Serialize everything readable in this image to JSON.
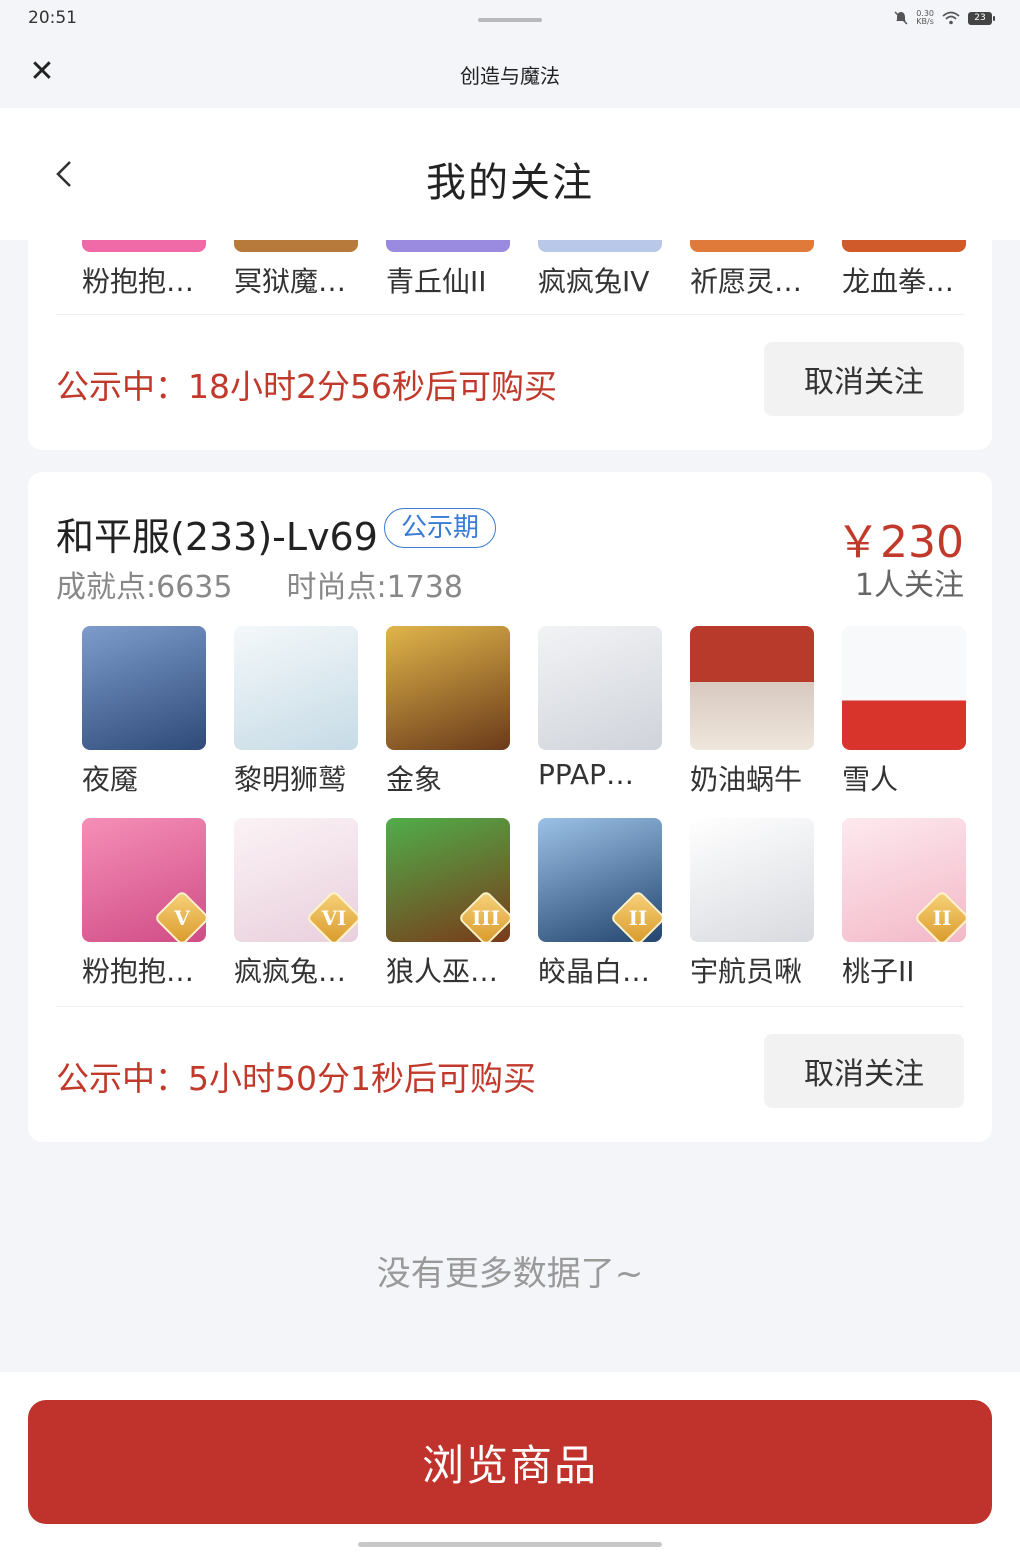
{
  "status_bar": {
    "time": "20:51",
    "net_speed_value": "0.30",
    "net_speed_unit": "KB/s",
    "battery": "23",
    "icons": [
      "bell-off-icon",
      "wifi-icon",
      "battery-icon"
    ]
  },
  "app_bar": {
    "title": "创造与魔法",
    "close_icon": "close-icon"
  },
  "page_header": {
    "title": "我的关注",
    "back_icon": "chevron-left-icon"
  },
  "card1": {
    "items": [
      {
        "label": "粉抱抱…",
        "color": "#f06aa8"
      },
      {
        "label": "冥狱魔…",
        "color": "#b87a3a"
      },
      {
        "label": "青丘仙II",
        "color": "#9b8be0"
      },
      {
        "label": "疯疯兔IV",
        "color": "#b9c7e8"
      },
      {
        "label": "祈愿灵…",
        "color": "#e07a3a"
      },
      {
        "label": "龙血拳…",
        "color": "#d05a2a"
      }
    ],
    "notice": "公示中：18小时2分56秒后可购买",
    "unfollow_label": "取消关注"
  },
  "card2": {
    "server": "和平服(233)-Lv69",
    "tag": "公示期",
    "price": "￥230",
    "achievement": "成就点:6635",
    "fashion": "时尚点:1738",
    "followers": "1人关注",
    "row1": [
      {
        "label": "夜魇",
        "color": "#4a6a9a"
      },
      {
        "label": "黎明狮鹫",
        "color": "#dfe9ef"
      },
      {
        "label": "金象",
        "color": "#b0802a"
      },
      {
        "label": "PPAP…",
        "color": "#e9ebef"
      },
      {
        "label": "奶油蜗牛",
        "color": "#b24a3a"
      },
      {
        "label": "雪人",
        "color": "#eef3f7"
      }
    ],
    "row2": [
      {
        "label": "粉抱抱…",
        "color": "#ee6f9f",
        "badge": "V"
      },
      {
        "label": "疯疯兔…",
        "color": "#f4e7ee",
        "badge": "VI"
      },
      {
        "label": "狼人巫…",
        "color": "#3a6a3a",
        "badge": "III"
      },
      {
        "label": "皎晶白…",
        "color": "#3a6aa0",
        "badge": "II"
      },
      {
        "label": "宇航员啾",
        "color": "#eaeaec"
      },
      {
        "label": "桃子II",
        "color": "#f7d6df",
        "badge": "II"
      }
    ],
    "notice": "公示中：5小时50分1秒后可购买",
    "unfollow_label": "取消关注"
  },
  "footer": {
    "no_more": "没有更多数据了~",
    "browse_label": "浏览商品"
  }
}
